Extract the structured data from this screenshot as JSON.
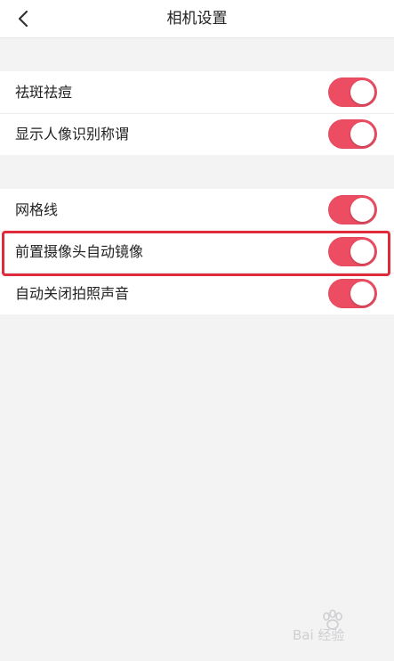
{
  "header": {
    "title": "相机设置",
    "back_icon": "chevron-left-icon"
  },
  "groups": [
    {
      "rows": [
        {
          "label": "祛斑祛痘",
          "enabled": true
        },
        {
          "label": "显示人像识别称谓",
          "enabled": true
        }
      ]
    },
    {
      "rows": [
        {
          "label": "网格线",
          "enabled": true
        },
        {
          "label": "前置摄像头自动镜像",
          "enabled": true,
          "highlighted": true
        },
        {
          "label": "自动关闭拍照声音",
          "enabled": true
        }
      ]
    }
  ],
  "colors": {
    "toggle_on": "#ec4d62",
    "highlight_border": "#e02b3c",
    "background": "#f3f3f4"
  },
  "watermark": {
    "text": "Bai 经验"
  }
}
